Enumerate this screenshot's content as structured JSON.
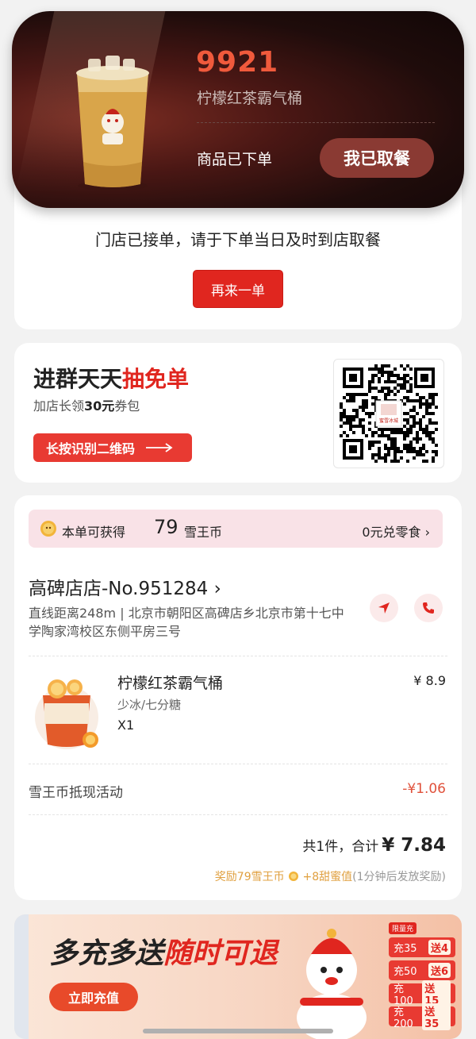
{
  "status": {
    "order_number_peek": "9921",
    "notice": "门店已接单，请于下单当日及时到店取餐",
    "reorder_label": "再来一单"
  },
  "live_banner": {
    "order_number": "9921",
    "product_name": "柠檬红茶霸气桶",
    "status_text": "商品已下单",
    "pickup_label": "我已取餐"
  },
  "group": {
    "title_prefix": "进群天天",
    "title_highlight": "抽免单",
    "subtitle_prefix": "加店长领",
    "subtitle_bold": "30元",
    "subtitle_suffix": "券包",
    "scan_label": "长按识别二维码",
    "qr_logo_text": "蜜雪冰城"
  },
  "coins": {
    "prefix": "本单可获得",
    "amount": "79",
    "suffix": "雪王币",
    "exchange_label": "0元兑零食"
  },
  "store": {
    "name": "高碑店店-No.951284",
    "address": "直线距离248m | 北京市朝阳区高碑店乡北京市第十七中学陶家湾校区东侧平房三号"
  },
  "product": {
    "name": "柠檬红茶霸气桶",
    "spec": "少冰/七分糖",
    "qty": "X1",
    "price": "¥ 8.9"
  },
  "discount": {
    "label": "雪王币抵现活动",
    "value": "-¥1.06"
  },
  "total": {
    "prefix": "共1件，合计",
    "amount": "¥ 7.84"
  },
  "reward": {
    "coins_text": "奖励79雪王币",
    "honey_text": "+8甜蜜值",
    "note": "(1分钟后发放奖励)"
  },
  "recharge": {
    "title_black": "多充多送",
    "title_red": "随时可退",
    "button_label": "立即充值",
    "tag": "限量充",
    "tiers": [
      {
        "charge": "充35",
        "give": "送4"
      },
      {
        "charge": "充50",
        "give": "送6"
      },
      {
        "charge": "充100",
        "give": "送15"
      },
      {
        "charge": "充200",
        "give": "送35"
      }
    ]
  },
  "colors": {
    "brand_red": "#e0261f",
    "order_number": "#f05a3c",
    "discount": "#e0513b",
    "reward": "#e0a040"
  }
}
